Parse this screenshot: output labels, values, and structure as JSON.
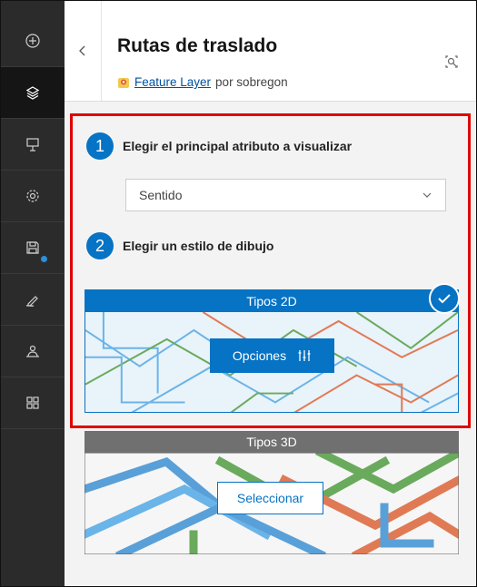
{
  "panel": {
    "title": "Rutas de traslado",
    "layer_type_link": "Feature Layer",
    "owner_text": "por sobregon"
  },
  "steps": [
    {
      "number": "1",
      "label": "Elegir el principal atributo a visualizar"
    },
    {
      "number": "2",
      "label": "Elegir un estilo de dibujo"
    }
  ],
  "attribute_select": {
    "value": "Sentido"
  },
  "styles": {
    "types_2d": {
      "title": "Tipos 2D",
      "button": "Opciones",
      "selected": true
    },
    "types_3d": {
      "title": "Tipos 3D",
      "button": "Seleccionar"
    }
  },
  "colors": {
    "accent": "#0673c4",
    "rail_bg": "#2b2b2b",
    "highlight_border": "#e00000",
    "line_blue": "#6ab4e8",
    "line_green": "#6aaa5c",
    "line_red": "#e07a55"
  },
  "rail_icons": [
    "add-icon",
    "layers-icon",
    "presentation-icon",
    "settings-icon",
    "save-icon",
    "sketch-icon",
    "share-icon",
    "apps-icon"
  ]
}
